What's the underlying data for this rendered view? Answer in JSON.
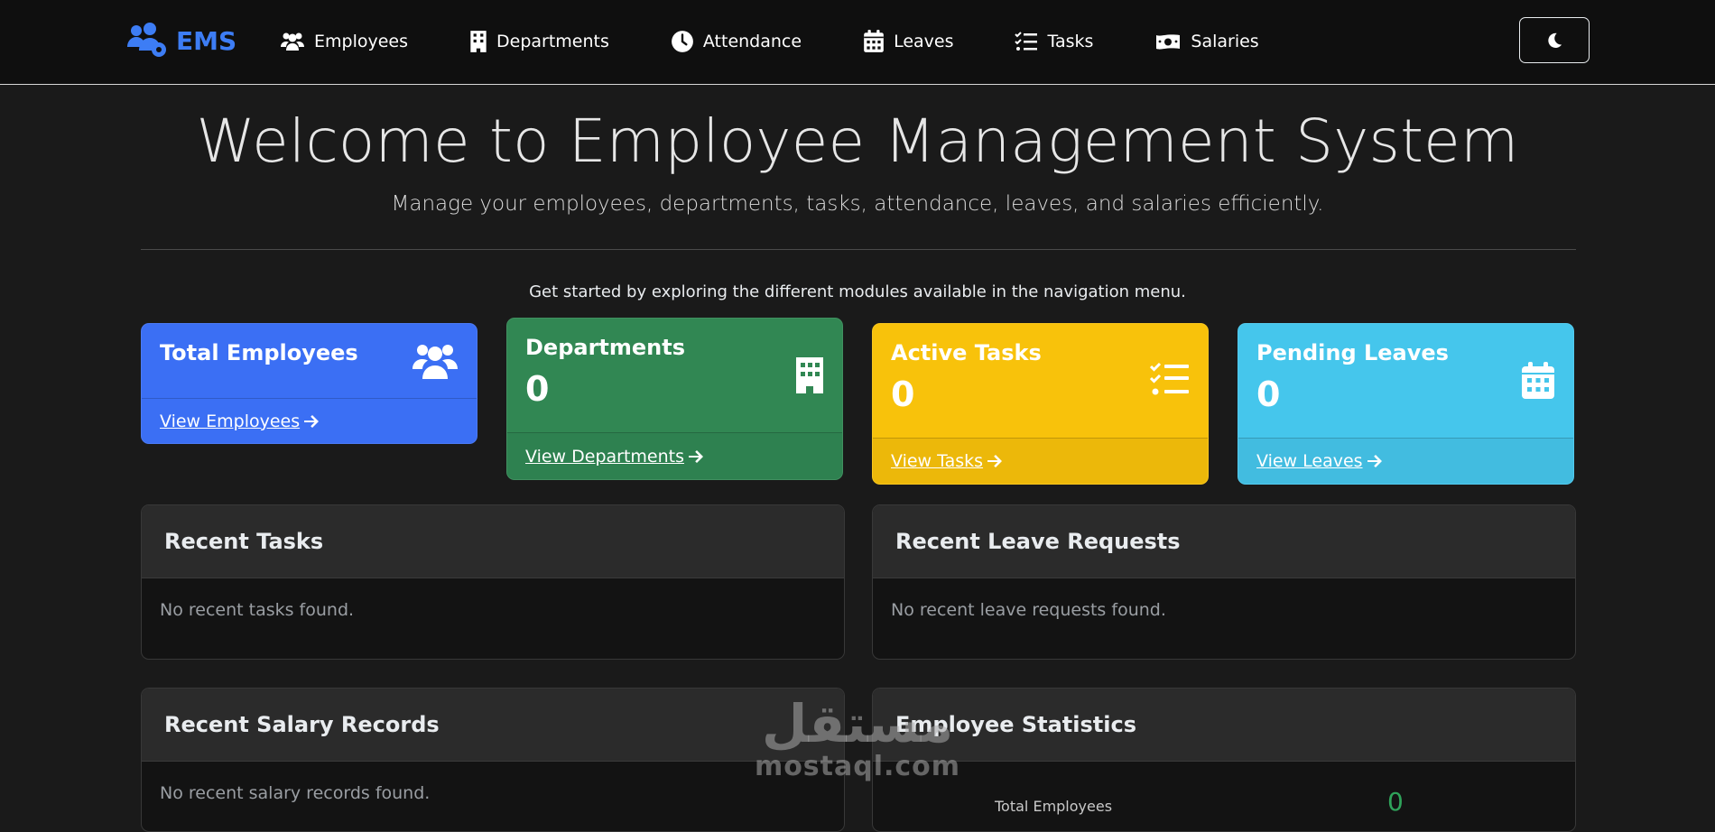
{
  "navbar": {
    "brand": "EMS",
    "items": [
      {
        "label": "Employees",
        "icon": "users-icon"
      },
      {
        "label": "Departments",
        "icon": "building-icon"
      },
      {
        "label": "Attendance",
        "icon": "clock-icon"
      },
      {
        "label": "Leaves",
        "icon": "calendar-icon"
      },
      {
        "label": "Tasks",
        "icon": "tasks-icon"
      },
      {
        "label": "Salaries",
        "icon": "money-icon"
      }
    ],
    "theme_toggle_icon": "moon-icon"
  },
  "hero": {
    "title": "Welcome to Employee Management System",
    "subtitle": "Manage your employees, departments, tasks, attendance, leaves, and salaries efficiently.",
    "hint": "Get started by exploring the different modules available in the navigation menu."
  },
  "cards": {
    "employees": {
      "title": "Total Employees",
      "link": "View Employees",
      "color": "#3b6ff4"
    },
    "departments": {
      "title": "Departments",
      "count": "0",
      "link": "View Departments",
      "color": "#318753"
    },
    "tasks": {
      "title": "Active Tasks",
      "count": "0",
      "link": "View Tasks",
      "color": "#f8c20b"
    },
    "leaves": {
      "title": "Pending Leaves",
      "count": "0",
      "link": "View Leaves",
      "color": "#45c6ec"
    }
  },
  "panels": {
    "recent_tasks": {
      "title": "Recent Tasks",
      "empty": "No recent tasks found."
    },
    "recent_leaves": {
      "title": "Recent Leave Requests",
      "empty": "No recent leave requests found."
    },
    "recent_salary": {
      "title": "Recent Salary Records",
      "empty": "No recent salary records found."
    },
    "employee_stats": {
      "title": "Employee Statistics",
      "rows": [
        {
          "label": "Total Employees",
          "value": "0"
        }
      ]
    }
  },
  "watermark": {
    "arabic": "مستقل",
    "latin": "mostaql.com"
  }
}
